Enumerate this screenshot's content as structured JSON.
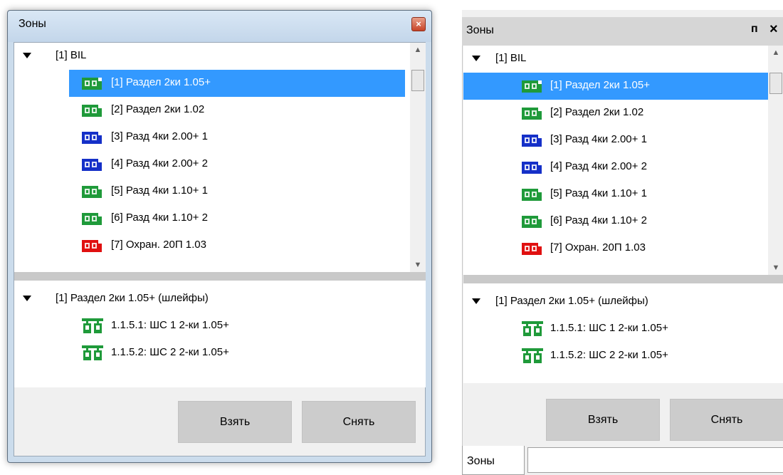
{
  "window_title": "Зоны",
  "zones_root_label": "[1] BIL",
  "zones": [
    {
      "label": "[1] Раздел 2ки 1.05+",
      "color": "#1f9a3a",
      "selected": true
    },
    {
      "label": "[2] Раздел 2ки 1.02",
      "color": "#1f9a3a",
      "selected": false
    },
    {
      "label": "[3] Разд 4ки 2.00+ 1",
      "color": "#1530c8",
      "selected": false
    },
    {
      "label": "[4] Разд 4ки 2.00+ 2",
      "color": "#1530c8",
      "selected": false
    },
    {
      "label": "[5] Разд 4ки 1.10+ 1",
      "color": "#1f9a3a",
      "selected": false
    },
    {
      "label": "[6] Разд 4ки 1.10+ 2",
      "color": "#1f9a3a",
      "selected": false
    },
    {
      "label": "[7] Охран. 20П 1.03",
      "color": "#e01010",
      "selected": false
    }
  ],
  "loops_root_label": "[1] Раздел 2ки 1.05+ (шлейфы)",
  "loops": [
    {
      "label": "1.1.5.1: ШС 1 2-ки 1.05+"
    },
    {
      "label": "1.1.5.2: ШС 2 2-ки 1.05+"
    }
  ],
  "buttons": {
    "take": "Взять",
    "release": "Снять"
  },
  "docked": {
    "pin_icon": "pin-icon",
    "close_icon": "close-icon",
    "tab_label": "Зоны"
  }
}
